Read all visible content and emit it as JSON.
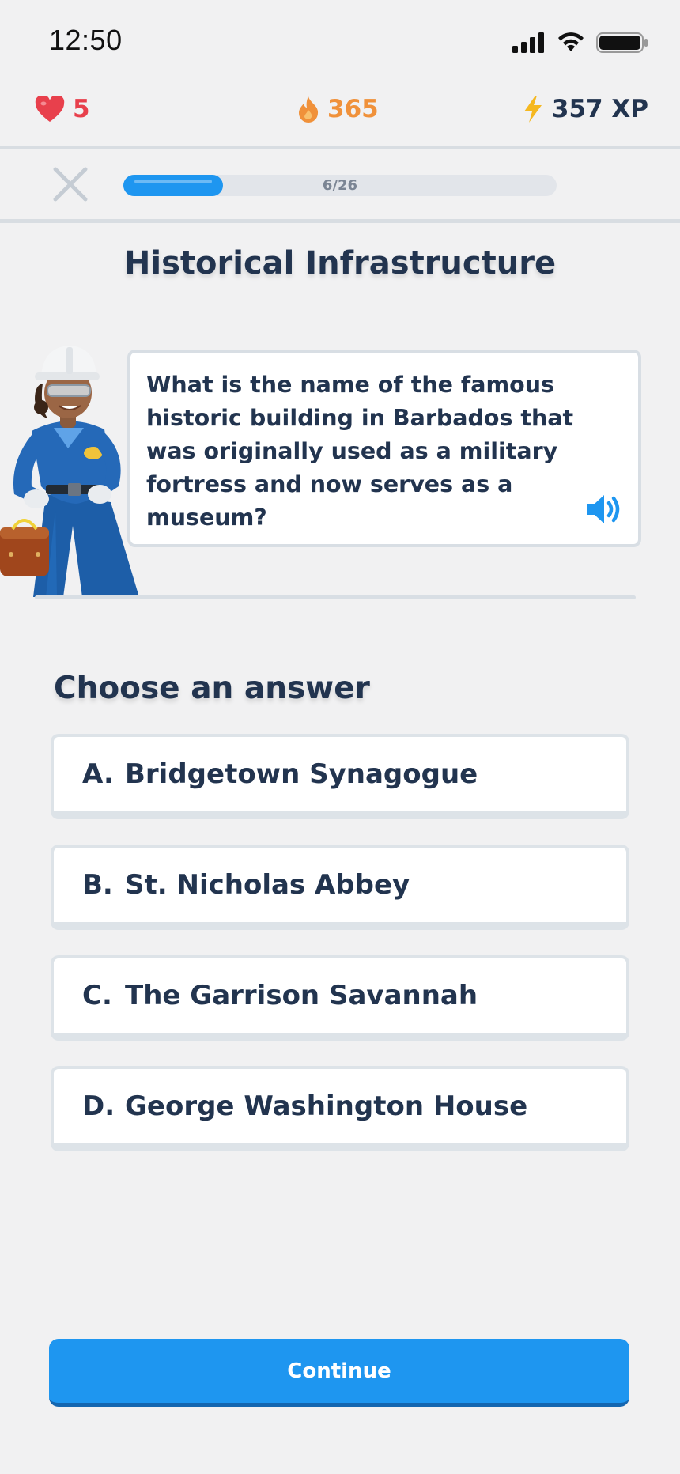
{
  "status_bar": {
    "time": "12:50",
    "icons": [
      "cellular-signal-icon",
      "wifi-icon",
      "battery-icon"
    ]
  },
  "stats": {
    "hearts": "5",
    "streak": "365",
    "xp": "357 XP"
  },
  "progress": {
    "label": "6/26",
    "fraction": 0.23
  },
  "lesson": {
    "title": "Historical Infrastructure",
    "question": "What is the name of the famous historic building in Barbados that was originally used as a military fortress and now serves as a museum?"
  },
  "answers": {
    "heading": "Choose an answer",
    "items": [
      {
        "letter": "A.",
        "text": "Bridgetown Synagogue"
      },
      {
        "letter": "B.",
        "text": "St. Nicholas Abbey"
      },
      {
        "letter": "C.",
        "text": "The Garrison Savannah"
      },
      {
        "letter": "D.",
        "text": "George Washington House"
      }
    ]
  },
  "continue_label": "Continue",
  "colors": {
    "accent": "#1e96f0",
    "heart": "#e8404c",
    "streak": "#f0913a",
    "xp_bolt": "#f5b820",
    "text": "#22344f"
  }
}
